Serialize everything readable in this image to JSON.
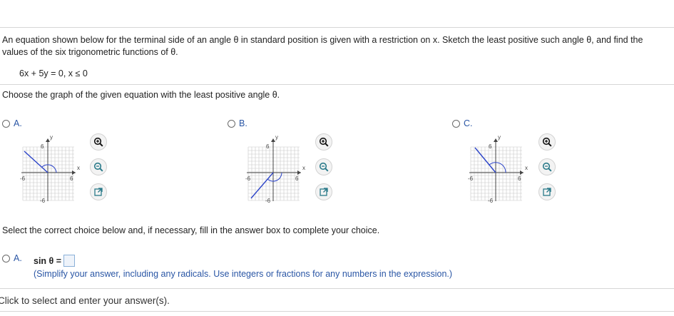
{
  "question": {
    "text": "An equation shown below for the terminal side of an angle θ in standard position is given with a restriction on x. Sketch the least positive such angle θ, and find the values of the six trigonometric functions of θ.",
    "equation": "6x + 5y = 0, x ≤ 0"
  },
  "choose_prompt": "Choose the graph of the given equation with the least positive angle θ.",
  "graph_options": [
    {
      "label": "A.",
      "axis_y": "y",
      "axis_x": "x",
      "tick_pos": "6",
      "tick_neg": "-6",
      "tick_x_neg": "-6",
      "tick_x_pos": "6"
    },
    {
      "label": "B.",
      "axis_y": "y",
      "axis_x": "x",
      "tick_pos": "6",
      "tick_neg": "-6",
      "tick_x_neg": "-6",
      "tick_x_pos": "6"
    },
    {
      "label": "C.",
      "axis_y": "y",
      "axis_x": "x",
      "tick_pos": "6",
      "tick_neg": "-6",
      "tick_x_neg": "-6",
      "tick_x_pos": "6"
    }
  ],
  "tools": {
    "zoom_in": "zoom-in-icon",
    "zoom_out": "zoom-out-icon",
    "expand": "expand-icon"
  },
  "select_prompt": "Select the correct choice below and, if necessary, fill in the answer box to complete your choice.",
  "answer": {
    "label": "A.",
    "expr": "sin θ =",
    "hint": "(Simplify your answer, including any radicals. Use integers or fractions for any numbers in the expression.)"
  },
  "footer": "Click to select and enter your answer(s).",
  "colors": {
    "accent": "#2a56a5",
    "line": "#2b43c8",
    "grid": "#c8c8c8"
  }
}
